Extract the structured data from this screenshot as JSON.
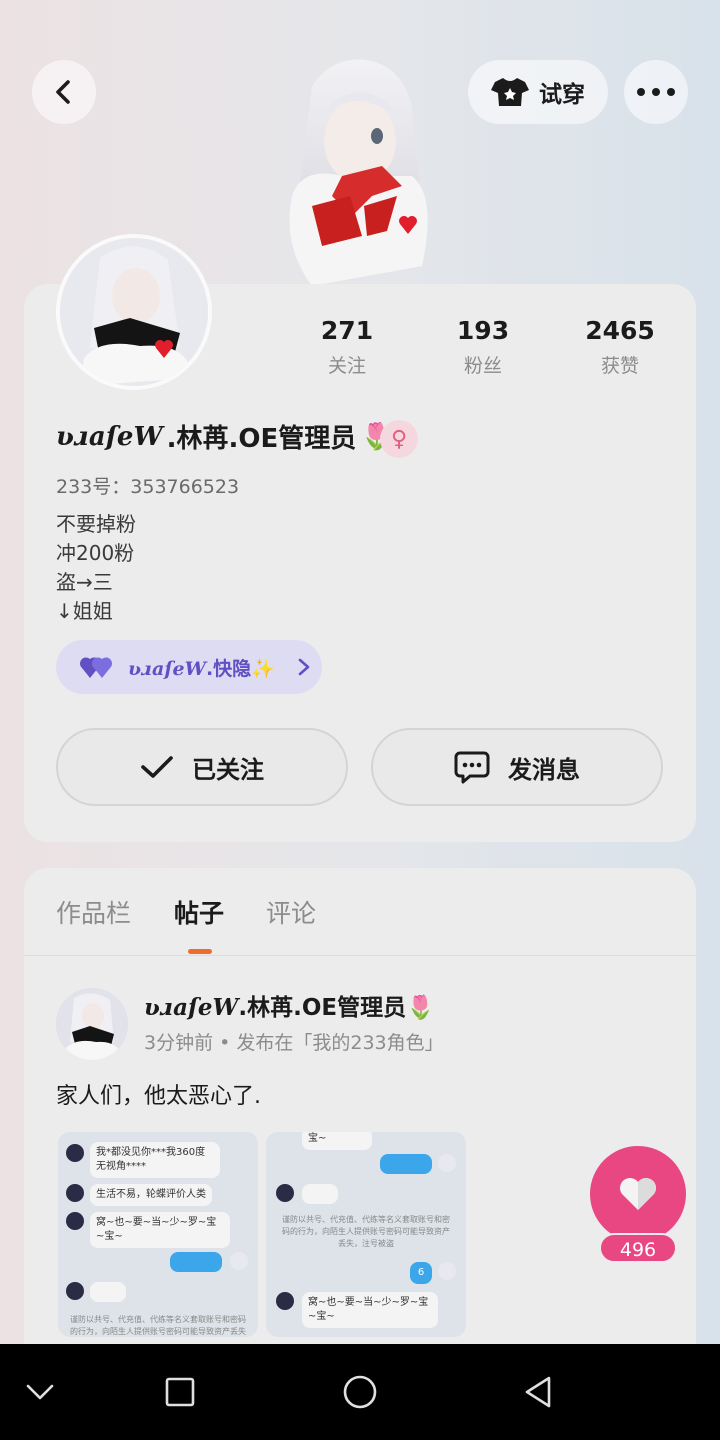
{
  "header": {
    "back_icon": "chevron-left-icon",
    "try_on_label": "试穿",
    "try_on_icon": "tshirt-icon",
    "more_icon": "more-dots-icon"
  },
  "profile": {
    "stats": [
      {
        "value": "271",
        "label": "关注"
      },
      {
        "value": "193",
        "label": "粉丝"
      },
      {
        "value": "2465",
        "label": "获赞"
      }
    ],
    "name_script": "ʋɹaſeW",
    "name_text": ".林苒.OE管理员",
    "name_emoji": "🌷",
    "gender_symbol": "♀",
    "uid": "233号：353766523",
    "bio": [
      "不要掉粉",
      "冲200粉",
      "盗→三",
      "↓姐姐"
    ],
    "family_script": "ʋɹaſeW",
    "family_text": ".快隐",
    "family_emoji": "✨",
    "follow_label": "已关注",
    "message_label": "发消息"
  },
  "tabs": [
    {
      "label": "作品栏",
      "active": false
    },
    {
      "label": "帖子",
      "active": true
    },
    {
      "label": "评论",
      "active": false
    }
  ],
  "post": {
    "author_script": "ʋɹaſeW",
    "author_text": ".林苒.OE管理员",
    "author_emoji": "🌷",
    "meta": "3分钟前 • 发布在「我的233角色」",
    "text": "家人们，他太恶心了.",
    "like_count": "496",
    "screenshot1": {
      "msg1": "我*都没见你***我360度无视角****",
      "msg2": "生活不易，轮蝶评价人类",
      "msg3": "窝~也~要~当~少~罗~宝~宝~",
      "sys": "谨防以共号、代充值、代练等名义套取账号和密码的行为，向陌生人提供账号密码可能导致资产丢失"
    },
    "screenshot2": {
      "msg0": "宝~",
      "num": "6",
      "msg3": "窝~也~要~当~少~罗~宝~宝~",
      "sys": "谨防以共号、代充值、代练等名义套取账号和密码的行为，向陌生人提供账号密码可能导致资产丢失，注号被盗"
    }
  },
  "colors": {
    "accent_pink": "#e84782",
    "tab_indicator": "#ee6d2d",
    "family_purple": "#6150c4"
  },
  "nav": {
    "back_icon": "nav-back-triangle-icon",
    "home_icon": "nav-home-circle-icon",
    "recent_icon": "nav-recent-square-icon",
    "collapse_icon": "nav-collapse-chevron-icon"
  }
}
